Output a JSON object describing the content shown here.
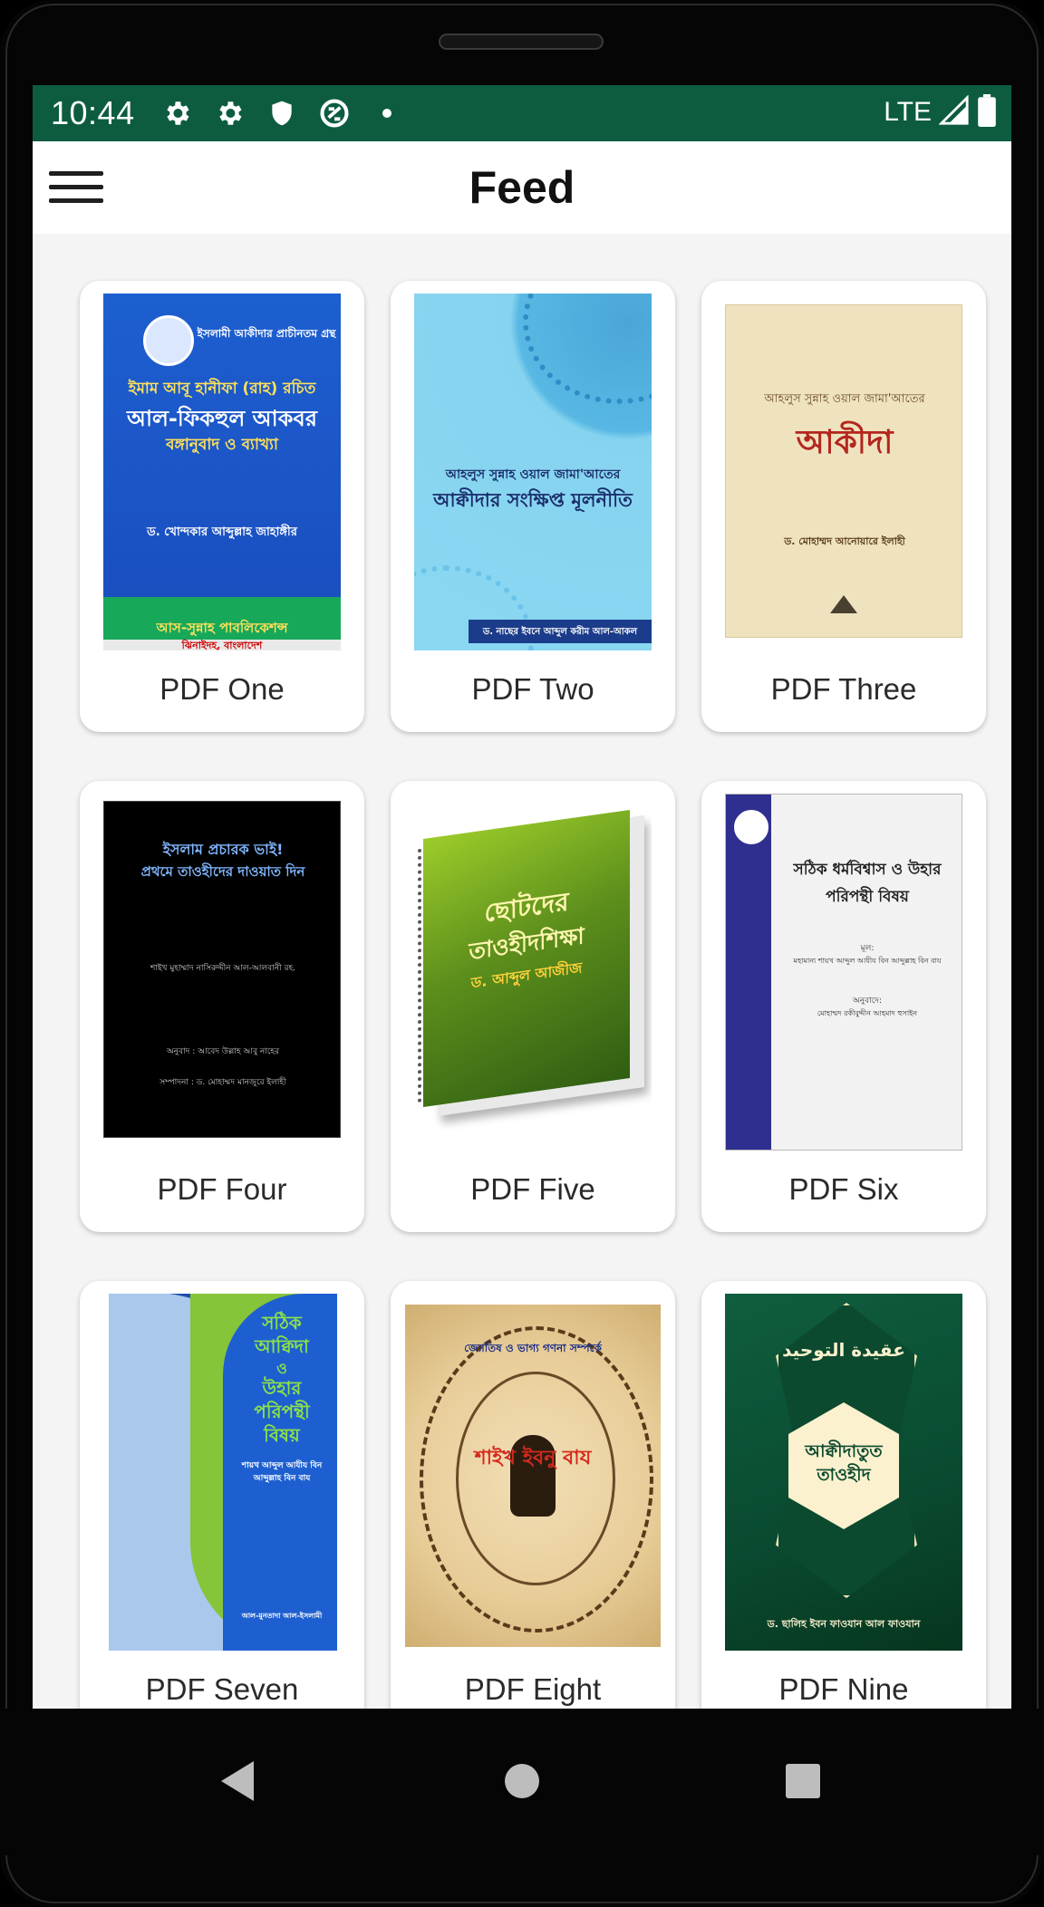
{
  "status_bar": {
    "time": "10:44",
    "network": "LTE",
    "icons": [
      "gear-icon",
      "gear-icon",
      "shield-icon",
      "data-saver-icon",
      "dot-icon",
      "signal-icon",
      "battery-icon"
    ],
    "background_color": "#0d5c40"
  },
  "app_bar": {
    "title": "Feed",
    "menu_icon": "hamburger-menu-icon"
  },
  "feed": {
    "items": [
      {
        "label": "PDF One"
      },
      {
        "label": "PDF Two"
      },
      {
        "label": "PDF Three"
      },
      {
        "label": "PDF Four"
      },
      {
        "label": "PDF Five"
      },
      {
        "label": "PDF Six"
      },
      {
        "label": "PDF Seven"
      },
      {
        "label": "PDF Eight"
      },
      {
        "label": "PDF Nine"
      }
    ]
  },
  "covers": {
    "one": {
      "top_line": "ইসলামী আকীদার প্রাচীনতম গ্রন্থ",
      "author_line": "ইমাম আবূ হানীফা (রাহ) রচিত",
      "title": "আল-ফিকহুল আকবর",
      "subtitle": "বঙ্গানুবাদ ও ব্যাখ্যা",
      "translator": "ড. খোন্দকার আব্দুল্লাহ জাহাঙ্গীর",
      "publisher": "আস-সুন্নাহ পাবলিকেশন্স",
      "place": "ঝিনাইদহ, বাংলাদেশ"
    },
    "two": {
      "top_line": "আহলুস সুন্নাহ ওয়াল জামা'আতের",
      "title": "আক্বীদার সংক্ষিপ্ত মূলনীতি",
      "author": "ড. নাছের ইবনে আব্দুল করীম আল-আকল"
    },
    "three": {
      "top_line": "আহলুস সুন্নাহ ওয়াল জামা'আতের",
      "title": "আকীদা",
      "author": "ড. মোহাম্মদ আনোয়ারে ইলাহী"
    },
    "four": {
      "line1": "ইসলাম প্রচারক ভাই!",
      "line2": "প্রথমে তাওহীদের দাওয়াত দিন",
      "line3": "শাইখ মুহাম্মাদ নাসিরুদ্দীন আল-আলবানী রহ.",
      "line4": "অনুবাদ : আবেদ উল্লাহ আবু নাহের",
      "line5": "সম্পাদনা : ড. মোহাম্মদ মানজুরে ইলাহী"
    },
    "five": {
      "title1": "ছোটদের",
      "title2": "তাওহীদশিক্ষা",
      "author": "ড. আব্দুল আজীজ"
    },
    "six": {
      "title1": "সঠিক ধর্মবিশ্বাস ও উহার",
      "title2": "পরিপন্থী বিষয়",
      "line1": "মূল:",
      "line2": "মহামান্য শায়খ আব্দুল আযীয বিন আব্দুল্লাহ বিন বায",
      "line3": "অনুবাদে:",
      "line4": "মোহাম্মদ রকীবুদ্দীন আহমাদ হুসাইন"
    },
    "seven": {
      "title1": "সঠিক",
      "title2": "আক্বিদা",
      "title3": "ও",
      "title4": "উহার",
      "title5": "পরিপন্থী",
      "title6": "বিষয়",
      "line1": "শায়খ আব্দুল আযীয বিন",
      "line2": "আব্দুল্লাহ বিন বায",
      "line3": "আল-মুনতাদা আল-ইসলামী"
    },
    "eight": {
      "title": "শাইখ ইবনু বায",
      "top_line": "জ্যোতিষ ও ভাগ্য গণনা সম্পর্কে"
    },
    "nine": {
      "arabic": "عقيدة التوحيد",
      "title1": "আক্বীদাতুত",
      "title2": "তাওহীদ",
      "author": "ড. ছালিহ ইবন ফাওযান আল ফাওযান"
    }
  },
  "nav_bar": {
    "back_icon": "back-triangle-icon",
    "home_icon": "home-circle-icon",
    "recents_icon": "recents-square-icon"
  }
}
